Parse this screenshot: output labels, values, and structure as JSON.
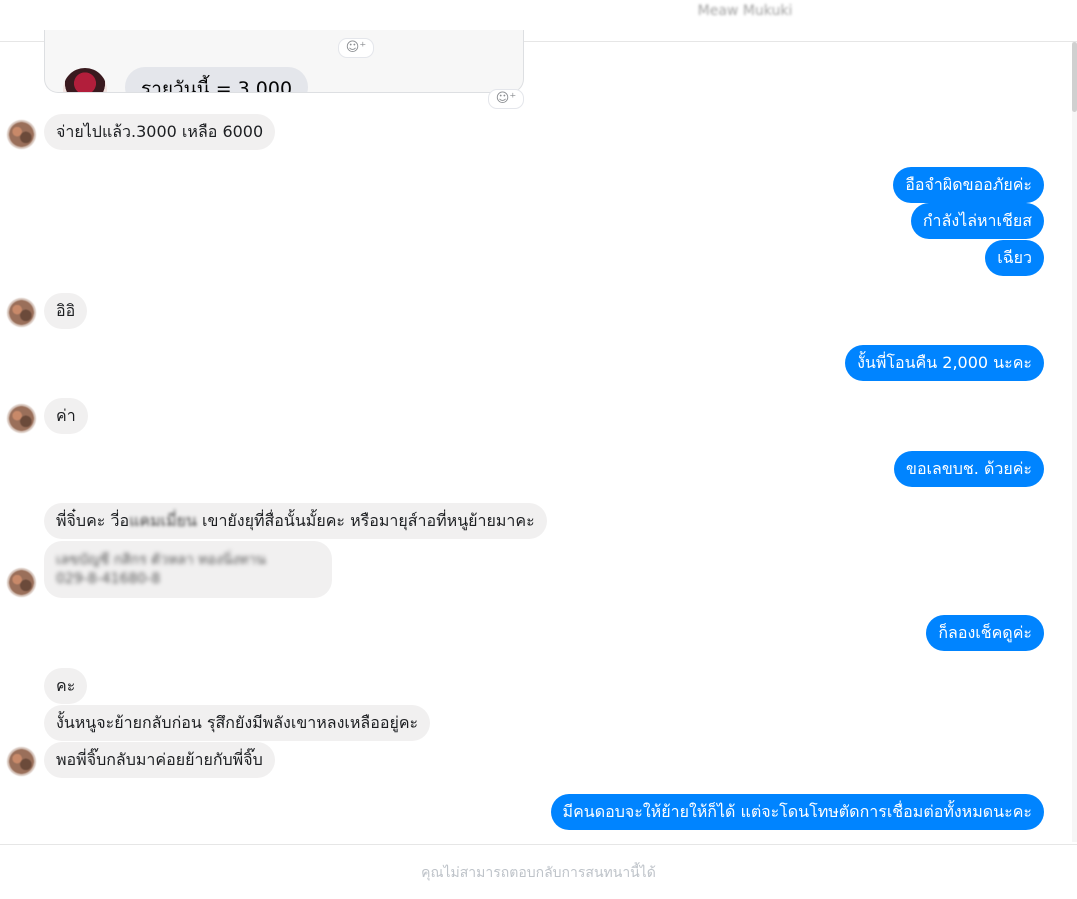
{
  "header": {
    "contact_name": "Meaw Mukuki"
  },
  "shared_card": {
    "bubble_text": "รายวันนี้ = 3,000"
  },
  "messages": [
    {
      "side": "in",
      "text": "จ่ายไปแล้ว.3000 เหลือ 6000"
    },
    {
      "side": "out",
      "text": "อือจำผิดขออภัยค่ะ"
    },
    {
      "side": "out",
      "text": "กำลังไล่หาเชียส"
    },
    {
      "side": "out",
      "text": "เฉียว"
    },
    {
      "side": "in",
      "text": "อิอิ"
    },
    {
      "side": "out",
      "text": "งั้นพี่โอนคืน 2,000 นะคะ"
    },
    {
      "side": "in",
      "text": "ค่า"
    },
    {
      "side": "out",
      "text": "ขอเลขบช. ด้วยค่ะ"
    },
    {
      "side": "in",
      "text_before": "พี่จิ๋บคะ วี่อ",
      "text_blurred": "แคมเมี่ยน",
      "text_after": " เขายังยุที่สื่อนั้นมั้ยคะ หรือมายุส์าอที่หนูย้ายมาคะ"
    },
    {
      "side": "in",
      "text_line1": "เลขบัญชี กสิกร ตัวหลา ทองนิ่งทาน",
      "text_line2": "029-8-41680-8"
    },
    {
      "side": "out",
      "text": "ก็ลองเช็คดูค่ะ"
    },
    {
      "side": "in",
      "text": "คะ"
    },
    {
      "side": "in",
      "text": "งั้นหนูจะย้ายกลับก่อน รุสึกยังมีพลังเขาหลงเหลืออยู่คะ"
    },
    {
      "side": "in",
      "text": "พอพี่จิ๊บกลับมาค่อยย้ายกับพี่จิ๊บ"
    },
    {
      "side": "out",
      "text": "มีคนดอบจะให้ย้ายให้ก็ได้ แต่จะโดนโทษตัดการเชื่อมต่อทั้งหมดนะคะ"
    }
  ],
  "footer": {
    "notice": "คุณไม่สามารถตอบกลับการสนทนานี้ได้"
  },
  "icons": {
    "reaction": "add-reaction-icon",
    "avatar": "contact-avatar"
  },
  "colors": {
    "outgoing_bubble": "#0084ff",
    "incoming_bubble": "#f1f0f0"
  }
}
